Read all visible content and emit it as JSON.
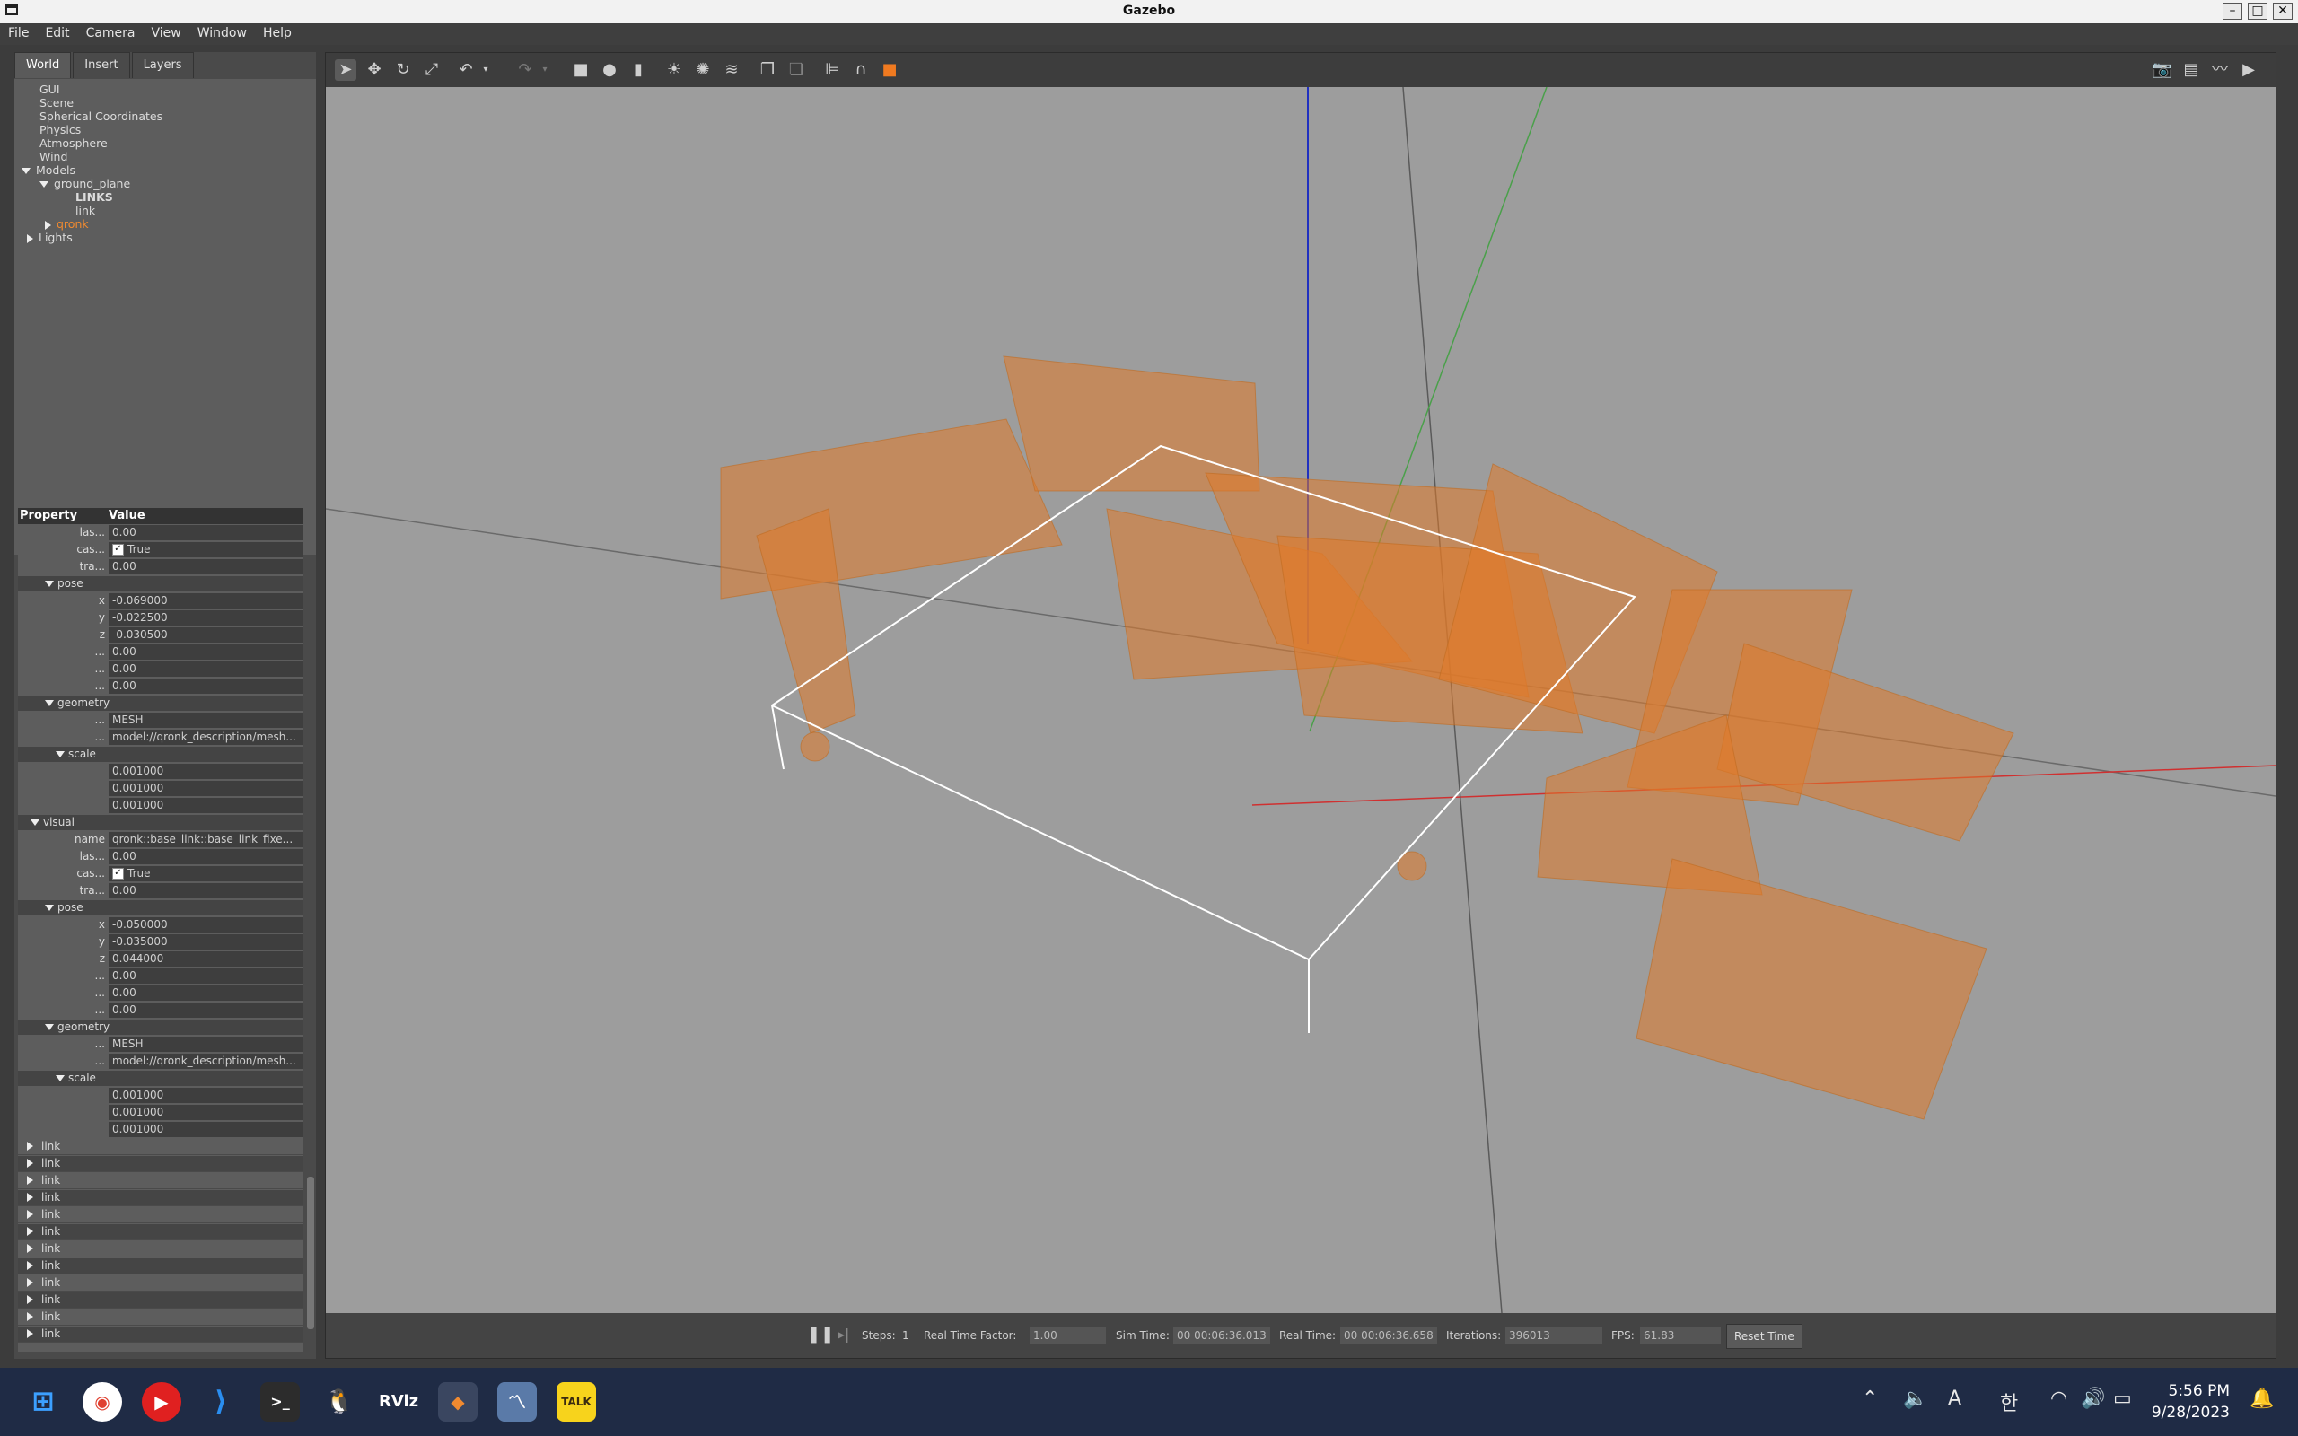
{
  "window": {
    "title": "Gazebo"
  },
  "menu": [
    "File",
    "Edit",
    "Camera",
    "View",
    "Window",
    "Help"
  ],
  "tabs": [
    "World",
    "Insert",
    "Layers"
  ],
  "tree": {
    "gui": "GUI",
    "scene": "Scene",
    "spherical": "Spherical Coordinates",
    "physics": "Physics",
    "atmosphere": "Atmosphere",
    "wind": "Wind",
    "models": "Models",
    "ground_plane": "ground_plane",
    "links_header": "LINKS",
    "link": "link",
    "qronk": "qronk",
    "lights": "Lights"
  },
  "properties": {
    "header_property": "Property",
    "header_value": "Value",
    "rows": [
      {
        "name": "las...",
        "value": "0.00"
      },
      {
        "name": "cas...",
        "value": "True",
        "checkbox": true
      },
      {
        "name": "tra...",
        "value": "0.00"
      },
      {
        "name": "pose",
        "section": true
      },
      {
        "name": "x",
        "value": "-0.069000"
      },
      {
        "name": "y",
        "value": "-0.022500"
      },
      {
        "name": "z",
        "value": "-0.030500"
      },
      {
        "name": "...",
        "value": "0.00"
      },
      {
        "name": "...",
        "value": "0.00"
      },
      {
        "name": "...",
        "value": "0.00"
      },
      {
        "name": "geometry",
        "section": true
      },
      {
        "name": "...",
        "value": "MESH"
      },
      {
        "name": "...",
        "value": "model://qronk_description/mesh..."
      },
      {
        "name": "scale",
        "section": true
      },
      {
        "name": "",
        "value": "0.001000"
      },
      {
        "name": "",
        "value": "0.001000"
      },
      {
        "name": "",
        "value": "0.001000"
      },
      {
        "name": "visual",
        "section": true
      },
      {
        "name": "name",
        "value": "qronk::base_link::base_link_fixe..."
      },
      {
        "name": "las...",
        "value": "0.00"
      },
      {
        "name": "cas...",
        "value": "True",
        "checkbox": true
      },
      {
        "name": "tra...",
        "value": "0.00"
      },
      {
        "name": "pose",
        "section": true
      },
      {
        "name": "x",
        "value": "-0.050000"
      },
      {
        "name": "y",
        "value": "-0.035000"
      },
      {
        "name": "z",
        "value": "0.044000"
      },
      {
        "name": "...",
        "value": "0.00"
      },
      {
        "name": "...",
        "value": "0.00"
      },
      {
        "name": "...",
        "value": "0.00"
      },
      {
        "name": "geometry",
        "section": true
      },
      {
        "name": "...",
        "value": "MESH"
      },
      {
        "name": "...",
        "value": "model://qronk_description/mesh..."
      },
      {
        "name": "scale",
        "section": true
      },
      {
        "name": "",
        "value": "0.001000"
      },
      {
        "name": "",
        "value": "0.001000"
      },
      {
        "name": "",
        "value": "0.001000"
      }
    ],
    "link_rows": [
      "link",
      "link",
      "link",
      "link",
      "link",
      "link",
      "link",
      "link",
      "link",
      "link",
      "link",
      "link"
    ]
  },
  "bottom": {
    "steps_label": "Steps:",
    "steps_value": "1",
    "rtf_label": "Real Time Factor:",
    "rtf_value": "1.00",
    "sim_label": "Sim Time:",
    "sim_value": "00 00:06:36.013",
    "real_label": "Real Time:",
    "real_value": "00 00:06:36.658",
    "iter_label": "Iterations:",
    "iter_value": "396013",
    "fps_label": "FPS:",
    "fps_value": "61.83",
    "reset_label": "Reset Time"
  },
  "taskbar": {
    "time": "5:56 PM",
    "date": "9/28/2023",
    "ime_a": "A",
    "ime_han": "한",
    "rviz": "RViz",
    "talk": "TALK"
  }
}
